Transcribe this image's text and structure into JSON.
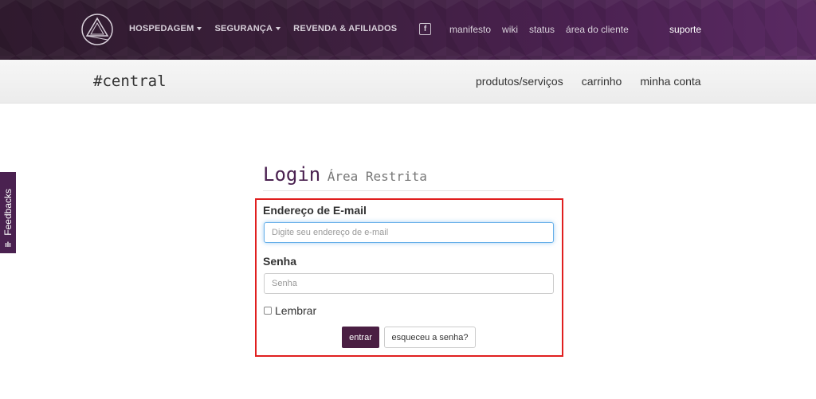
{
  "topnav": {
    "logo_icon": "triangle-logo-icon",
    "left_items": [
      {
        "label": "HOSPEDAGEM",
        "dropdown": true
      },
      {
        "label": "SEGURANÇA",
        "dropdown": true
      },
      {
        "label": "REVENDA & AFILIADOS",
        "dropdown": false
      }
    ],
    "facebook_icon": "facebook-icon",
    "facebook_glyph": "f",
    "mid_items": [
      "manifesto",
      "wiki",
      "status",
      "área do cliente"
    ],
    "suporte": "suporte"
  },
  "subnav": {
    "brand": "#central",
    "items": [
      "produtos/serviços",
      "carrinho",
      "minha conta"
    ]
  },
  "feedback": {
    "label": "Feedbacks",
    "icon": "feedback-bars-icon",
    "glyph": "ılı"
  },
  "login": {
    "title": "Login",
    "subtitle": "Área Restrita",
    "email_label": "Endereço de E-mail",
    "email_placeholder": "Digite seu endereço de e-mail",
    "password_label": "Senha",
    "password_placeholder": "Senha",
    "remember_label": "Lembrar",
    "submit_label": "entrar",
    "forgot_label": "esqueceu a senha?"
  },
  "colors": {
    "brand_purple": "#4a2150",
    "highlight_red": "#e01f1f"
  }
}
